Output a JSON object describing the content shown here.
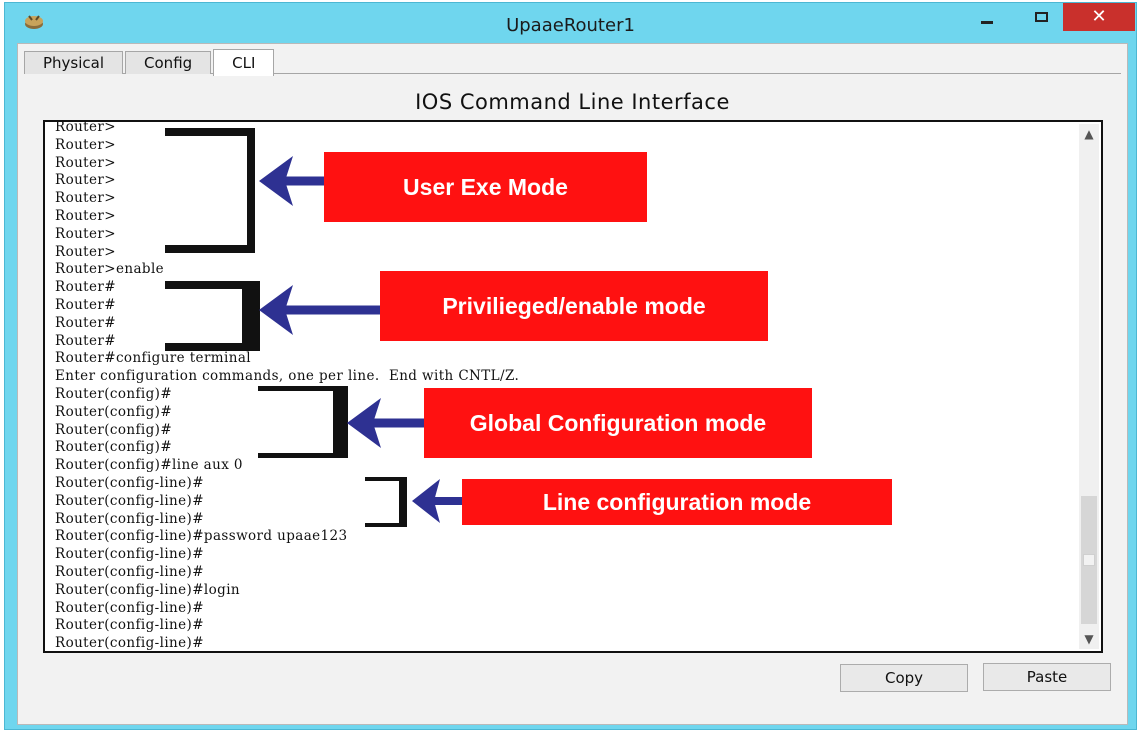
{
  "window": {
    "title": "UpaaeRouter1",
    "close_symbol": "✕",
    "app_icon": "router-icon"
  },
  "tabs": [
    {
      "label": "Physical",
      "active": false
    },
    {
      "label": "Config",
      "active": false
    },
    {
      "label": "CLI",
      "active": true
    }
  ],
  "cli": {
    "heading": "IOS Command Line Interface",
    "lines": [
      "Router>",
      "Router>",
      "Router>",
      "Router>",
      "Router>",
      "Router>",
      "Router>",
      "Router>",
      "Router>enable",
      "Router#",
      "Router#",
      "Router#",
      "Router#",
      "Router#configure terminal",
      "Enter configuration commands, one per line.  End with CNTL/Z.",
      "Router(config)#",
      "Router(config)#",
      "Router(config)#",
      "Router(config)#",
      "Router(config)#line aux 0",
      "Router(config-line)#",
      "Router(config-line)#",
      "Router(config-line)#",
      "Router(config-line)#password upaae123",
      "Router(config-line)#",
      "Router(config-line)#",
      "Router(config-line)#login",
      "Router(config-line)#",
      "Router(config-line)#",
      "Router(config-line)#"
    ]
  },
  "annotations": {
    "user_exec": "User Exe Mode",
    "privileged": "Privilieged/enable mode",
    "global_config": "Global Configuration mode",
    "line_config": "Line configuration mode"
  },
  "colors": {
    "window_frame": "#6fd6ee",
    "close_button": "#c9302c",
    "callout": "#ff1111",
    "arrow": "#2e3192"
  },
  "buttons": {
    "copy": "Copy",
    "paste": "Paste"
  }
}
